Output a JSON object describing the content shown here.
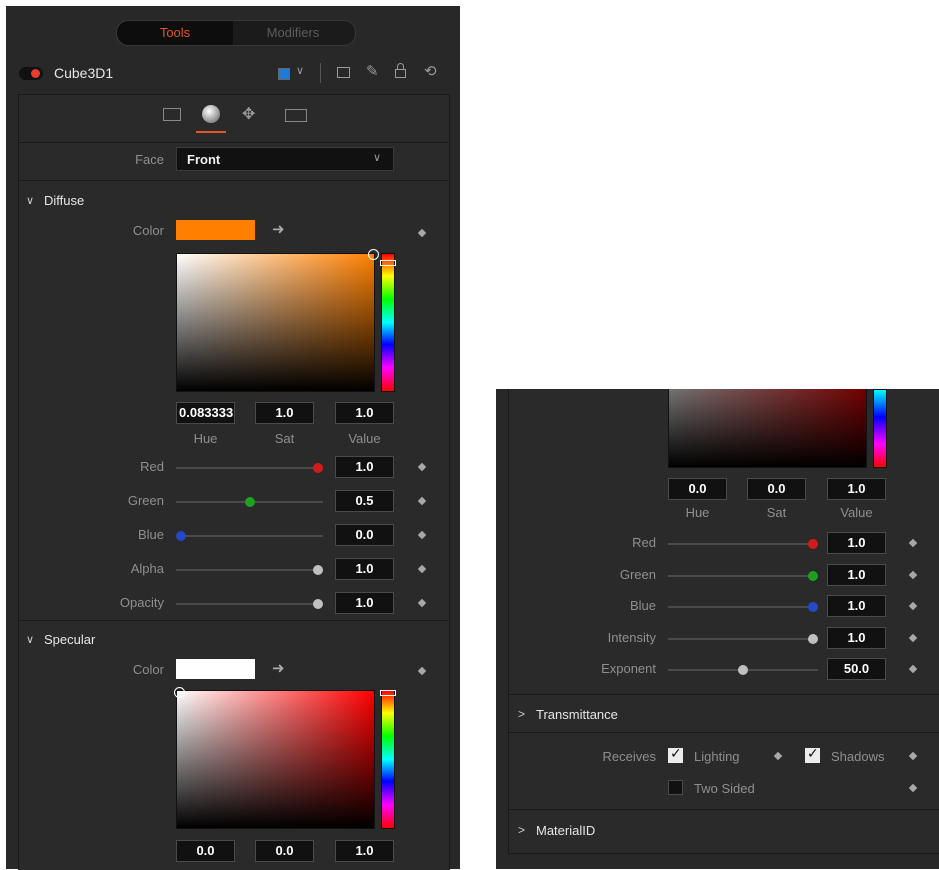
{
  "tabs": {
    "tools": "Tools",
    "modifiers": "Modifiers"
  },
  "node": {
    "name": "Cube3D1"
  },
  "face": {
    "label": "Face",
    "value": "Front"
  },
  "diffuse": {
    "header": "Diffuse",
    "color_label": "Color",
    "swatch_color": "#ff8000",
    "hsv": {
      "hue": "0.083333",
      "sat": "1.0",
      "value": "1.0"
    },
    "hsv_labels": {
      "hue": "Hue",
      "sat": "Sat",
      "value": "Value"
    },
    "sliders": [
      {
        "label": "Red",
        "value": "1.0",
        "fraction": 1.0,
        "knob_color": "#d21b1b"
      },
      {
        "label": "Green",
        "value": "0.5",
        "fraction": 0.5,
        "knob_color": "#1fa01f"
      },
      {
        "label": "Blue",
        "value": "0.0",
        "fraction": 0.0,
        "knob_color": "#2448c8"
      },
      {
        "label": "Alpha",
        "value": "1.0",
        "fraction": 1.0,
        "knob_color": "#c0c0c0"
      },
      {
        "label": "Opacity",
        "value": "1.0",
        "fraction": 1.0,
        "knob_color": "#c0c0c0"
      }
    ]
  },
  "specular": {
    "header": "Specular",
    "color_label": "Color",
    "swatch_color": "#ffffff",
    "hsv": {
      "hue": "0.0",
      "sat": "0.0",
      "value": "1.0"
    }
  },
  "right": {
    "hsv": {
      "hue": "0.0",
      "sat": "0.0",
      "value": "1.0"
    },
    "hsv_labels": {
      "hue": "Hue",
      "sat": "Sat",
      "value": "Value"
    },
    "sliders": [
      {
        "label": "Red",
        "value": "1.0",
        "fraction": 1.0,
        "knob_color": "#d21b1b"
      },
      {
        "label": "Green",
        "value": "1.0",
        "fraction": 1.0,
        "knob_color": "#1fa01f"
      },
      {
        "label": "Blue",
        "value": "1.0",
        "fraction": 1.0,
        "knob_color": "#2448c8"
      },
      {
        "label": "Intensity",
        "value": "1.0",
        "fraction": 1.0,
        "knob_color": "#c0c0c0"
      },
      {
        "label": "Exponent",
        "value": "50.0",
        "fraction": 0.5,
        "knob_color": "#c0c0c0"
      }
    ],
    "transmittance": "Transmittance",
    "receives": {
      "label": "Receives",
      "lighting": "Lighting",
      "shadows": "Shadows",
      "lighting_checked": true,
      "shadows_checked": true
    },
    "two_sided": {
      "label": "Two Sided",
      "checked": false
    },
    "material_id": "MaterialID"
  }
}
